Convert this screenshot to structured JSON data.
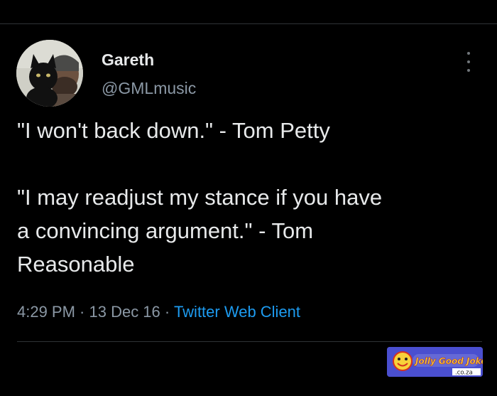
{
  "tweet": {
    "author": {
      "display_name": "Gareth",
      "handle": "@GMLmusic",
      "avatar_icon": "profile-photo-with-black-cat"
    },
    "text_lines": [
      "\"I won't back down.\" - Tom Petty",
      "\"I may readjust my stance if you have",
      "a convincing argument.\" - Tom",
      "Reasonable"
    ],
    "timestamp": "4:29 PM · 13 Dec 16 · ",
    "client": "Twitter Web Client"
  },
  "watermark": {
    "text": "Jolly Good Jokes",
    "suffix": ".co.za"
  },
  "colors": {
    "background": "#000000",
    "text_primary": "#e7e9ea",
    "text_secondary": "#8b98a5",
    "link": "#1d9bf0",
    "divider": "#2f3336"
  }
}
